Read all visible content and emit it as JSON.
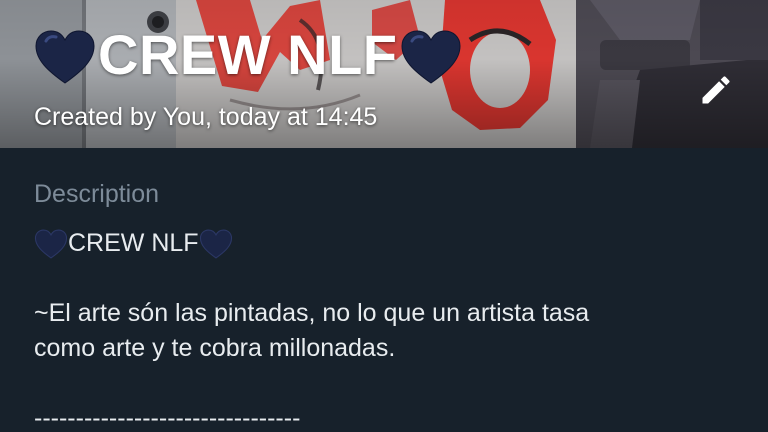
{
  "header": {
    "title": "CREW NLF",
    "title_emoji": "blue-heart-emoji",
    "subtitle": "Created by You, today at 14:45",
    "edit_icon": "pencil-icon"
  },
  "info": {
    "section_label": "Description",
    "description_title": "CREW NLF",
    "description_lines": [
      "~El arte són las pintadas, no lo que un artista tasa",
      "como arte y te cobra millonadas.",
      "",
      "--------------------------------"
    ]
  },
  "colors": {
    "background": "#17212b",
    "label": "#7d8b99",
    "text": "#e8ecef",
    "heart": "#1b2546"
  }
}
